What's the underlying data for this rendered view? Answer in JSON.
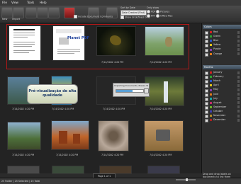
{
  "menu": [
    "File",
    "View",
    "Tools",
    "Help"
  ],
  "toolbar": {
    "buttons": [
      "New",
      "Import",
      "Delete",
      "Print",
      "Email",
      "Export",
      "Convert",
      "Merge",
      "Thumbnails"
    ],
    "include_document_comments": "Include Document Comments",
    "sort_by_label": "Sort by Date",
    "sort_value": "Date Created (First)",
    "show_undefined": "Show Undefined Only",
    "filter_title": "Only show",
    "filter_options": [
      "PDF",
      "Pictures",
      "RTF",
      "Office files"
    ]
  },
  "captions": {
    "row1": [
      "",
      "",
      "7/14/2002 4:20 PM",
      "7/14/2002 4:20 PM"
    ],
    "row2": [
      "7/14/2002 4:20 PM",
      "7/14/2002 4:20 PM",
      "7/14/2002 4:20 PM",
      "7/14/2002 4:20 PM",
      "7/14/2002 4:20 PM",
      "7/14/2002 4:20 PM"
    ],
    "row3": [
      "7/14/2002 4:20 PM",
      "7/14/2002 4:20 PM",
      "7/14/2002 4:20 PM",
      "7/14/2002 4:20 PM",
      "7/14/2002 4:20 PM"
    ],
    "row4": [
      "",
      "",
      "",
      ""
    ]
  },
  "thumb_text": {
    "pdf_logo": "Planet PDF"
  },
  "tooltip": "Pré-visualização de alta qualidade",
  "progress": {
    "text": "Importing Documents, Please Wait...",
    "percent": 60
  },
  "panel": {
    "colors_header": "Colors",
    "colors": [
      {
        "label": "Red",
        "color": "#d62020"
      },
      {
        "label": "Green",
        "color": "#2fa12f"
      },
      {
        "label": "Blue",
        "color": "#2a56c8"
      },
      {
        "label": "Yellow",
        "color": "#e0c21a"
      },
      {
        "label": "Purple",
        "color": "#8a3fb0"
      },
      {
        "label": "Orange",
        "color": "#e07a18"
      }
    ],
    "months_header": "Months",
    "months": [
      {
        "label": "January",
        "color": "#d62020"
      },
      {
        "label": "February",
        "color": "#2fa12f"
      },
      {
        "label": "March",
        "color": "#2a56c8"
      },
      {
        "label": "April",
        "color": "#e0c21a"
      },
      {
        "label": "May",
        "color": "#8a3fb0"
      },
      {
        "label": "June",
        "color": "#e07a18"
      },
      {
        "label": "July",
        "color": "#1aa5a5"
      },
      {
        "label": "August",
        "color": "#c12c6b"
      },
      {
        "label": "September",
        "color": "#6bb12a"
      },
      {
        "label": "October",
        "color": "#3f3fb0"
      },
      {
        "label": "November",
        "color": "#b08a2a"
      },
      {
        "label": "December",
        "color": "#aa2222"
      }
    ]
  },
  "pager": "Page 1 of 1",
  "status": {
    "left": "25 Folder | 25 Selected | 25 Total",
    "help": "Drag and drop labels on documents to link them"
  }
}
